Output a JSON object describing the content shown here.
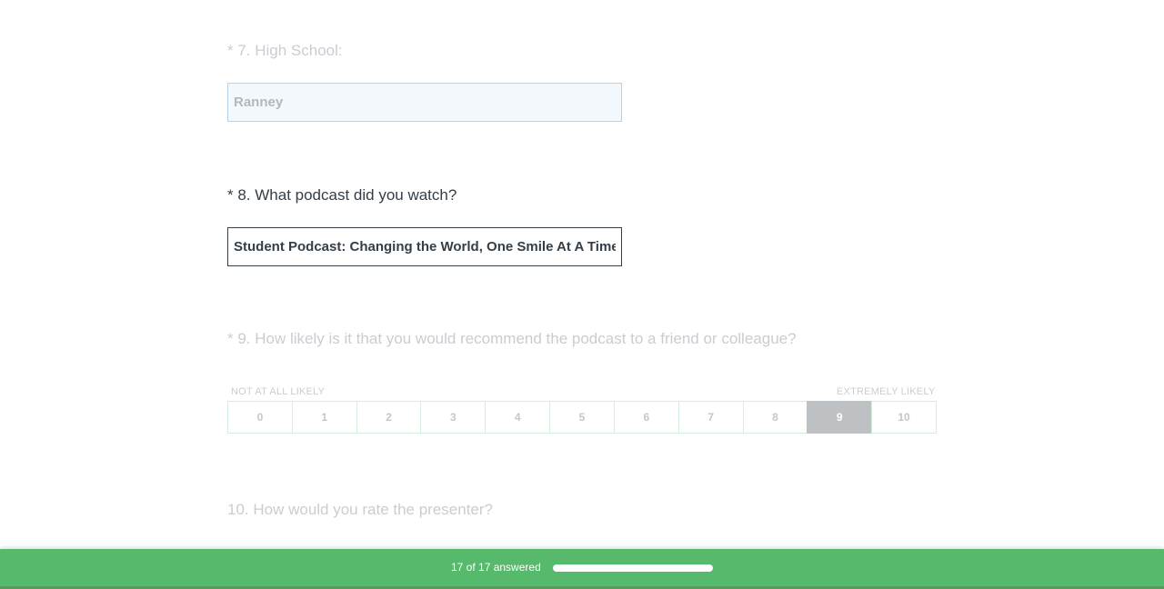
{
  "questions": {
    "q7": {
      "title": "* 7. High School:",
      "value": "Ranney"
    },
    "q8": {
      "title": "* 8. What podcast did you watch?",
      "value": "Student Podcast: Changing the World, One Smile At A Time"
    },
    "q9": {
      "title": "* 9. How likely is it that you would recommend the podcast to a friend or colleague?",
      "low_label": "NOT AT ALL LIKELY",
      "high_label": "EXTREMELY LIKELY",
      "options": [
        "0",
        "1",
        "2",
        "3",
        "4",
        "5",
        "6",
        "7",
        "8",
        "9",
        "10"
      ],
      "selected": "9"
    },
    "q10": {
      "title": "10. How would you rate the presenter?"
    }
  },
  "progress": {
    "text": "17 of 17 answered",
    "answered": 17,
    "total": 17,
    "fraction": 1.0
  },
  "colors": {
    "accent_green": "#57b96c",
    "selected_gray": "#bdc1c4"
  }
}
